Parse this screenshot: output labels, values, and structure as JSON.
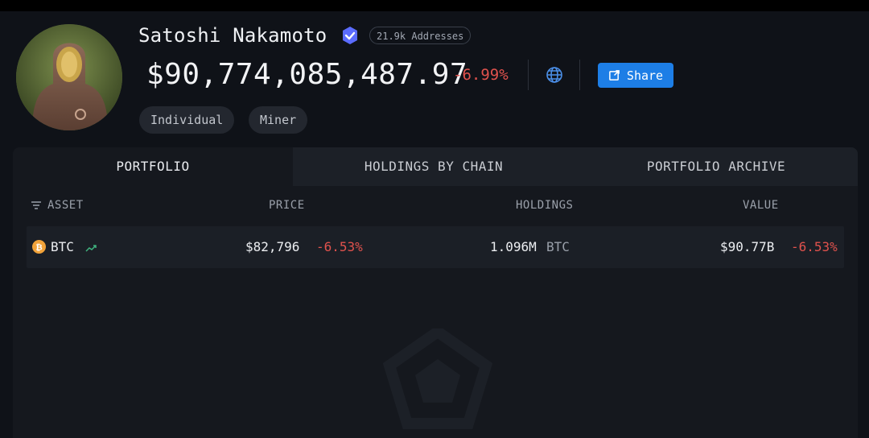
{
  "profile": {
    "name": "Satoshi Nakamoto",
    "addresses_badge": "21.9k Addresses",
    "total_value": "$90,774,085,487.97",
    "total_change": "-6.99%",
    "share_label": "Share",
    "tags": [
      "Individual",
      "Miner"
    ]
  },
  "tabs": [
    {
      "label": "PORTFOLIO",
      "active": true
    },
    {
      "label": "HOLDINGS BY CHAIN",
      "active": false
    },
    {
      "label": "PORTFOLIO ARCHIVE",
      "active": false
    }
  ],
  "table": {
    "headers": {
      "asset": "ASSET",
      "price": "PRICE",
      "holdings": "HOLDINGS",
      "value": "VALUE"
    },
    "rows": [
      {
        "asset": "BTC",
        "price": "$82,796",
        "price_change": "-6.53%",
        "holdings_amount": "1.096M",
        "holdings_unit": "BTC",
        "value": "$90.77B",
        "value_change": "-6.53%"
      }
    ]
  },
  "colors": {
    "accent": "#1d7ee6",
    "negative": "#e0524d",
    "verify_badge": "#5b6cff",
    "btc": "#f2a33a"
  },
  "icons": [
    "verified-badge-icon",
    "globe-icon",
    "external-link-icon",
    "filter-icon",
    "btc-icon",
    "trend-up-icon",
    "arkham-logo-watermark"
  ]
}
